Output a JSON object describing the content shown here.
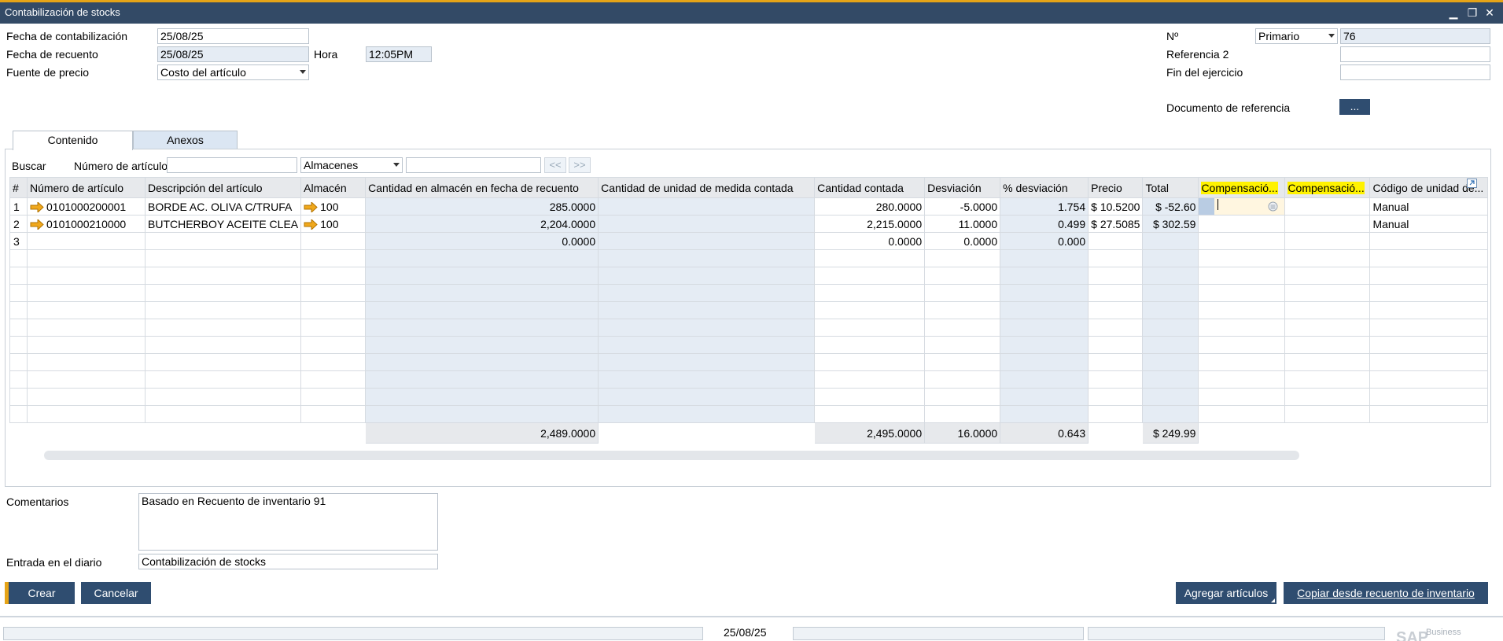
{
  "window": {
    "title": "Contabilización de stocks",
    "min": "▁",
    "restore": "❐",
    "close": "✕"
  },
  "header": {
    "fecha_contab_label": "Fecha de contabilización",
    "fecha_contab": "25/08/25",
    "fecha_recuento_label": "Fecha de recuento",
    "fecha_recuento": "25/08/25",
    "hora_label": "Hora",
    "hora": "12:05PM",
    "fuente_label": "Fuente de precio",
    "fuente": "Costo del artículo",
    "no_label": "Nº",
    "serie": "Primario",
    "numero": "76",
    "ref2_label": "Referencia 2",
    "ref2": "",
    "fin_label": "Fin del ejercicio",
    "fin": "",
    "docref_label": "Documento de referencia",
    "docref_btn": "..."
  },
  "tabs": {
    "contenido": "Contenido",
    "anexos": "Anexos"
  },
  "search": {
    "buscar_label": "Buscar",
    "articulo_label": "Número de artículo",
    "articulo": "",
    "almacenes": "Almacenes",
    "term": "",
    "prev": "<<",
    "next": ">>"
  },
  "grid": {
    "headers": {
      "n": "#",
      "num": "Número de artículo",
      "desc": "Descripción del artículo",
      "alm": "Almacén",
      "cant_alm": "Cantidad en almacén en fecha de recuento",
      "cant_um": "Cantidad de unidad de medida contada",
      "cant_cont": "Cantidad contada",
      "desv": "Desviación",
      "pdesv": "% desviación",
      "precio": "Precio",
      "total": "Total",
      "comp1": "Compensació...",
      "comp2": "Compensació...",
      "cod": "Código de unidad de..."
    },
    "rows": [
      {
        "n": "1",
        "num": "0101000200001",
        "desc": "BORDE AC. OLIVA C/TRUFA",
        "alm": "100",
        "cant_alm": "285.0000",
        "cant_um": "",
        "cant_cont": "280.0000",
        "desv": "-5.0000",
        "pdesv": "1.754",
        "precio": "$ 10.5200",
        "total": "$ -52.60",
        "comp1": "",
        "comp2": "",
        "cod": "Manual"
      },
      {
        "n": "2",
        "num": "0101000210000",
        "desc": "BUTCHERBOY ACEITE CLEA",
        "alm": "100",
        "cant_alm": "2,204.0000",
        "cant_um": "",
        "cant_cont": "2,215.0000",
        "desv": "11.0000",
        "pdesv": "0.499",
        "precio": "$ 27.5085",
        "total": "$ 302.59",
        "comp1": "",
        "comp2": "",
        "cod": "Manual"
      },
      {
        "n": "3",
        "num": "",
        "desc": "",
        "alm": "",
        "cant_alm": "0.0000",
        "cant_um": "",
        "cant_cont": "0.0000",
        "desv": "0.0000",
        "pdesv": "0.000",
        "precio": "",
        "total": "",
        "comp1": "",
        "comp2": "",
        "cod": ""
      }
    ],
    "totals": {
      "cant_alm": "2,489.0000",
      "cant_cont": "2,495.0000",
      "desv": "16.0000",
      "pdesv": "0.643",
      "total": "$ 249.99"
    }
  },
  "footer": {
    "comentarios_label": "Comentarios",
    "comentarios": "Basado en Recuento de inventario 91",
    "diario_label": "Entrada en el diario",
    "diario": "Contabilización de stocks"
  },
  "buttons": {
    "crear": "Crear",
    "cancelar": "Cancelar",
    "agregar": "Agregar artículos",
    "copiar": "Copiar desde recuento de inventario"
  },
  "statusbar": {
    "date": "25/08/25",
    "logo": "SAP",
    "logo_sub": "Business"
  },
  "colors": {
    "accent": "#e6a417",
    "button": "#2f4d70",
    "titlebar": "#334a66",
    "readonly": "#e5ecf4",
    "highlight": "#fff200"
  }
}
